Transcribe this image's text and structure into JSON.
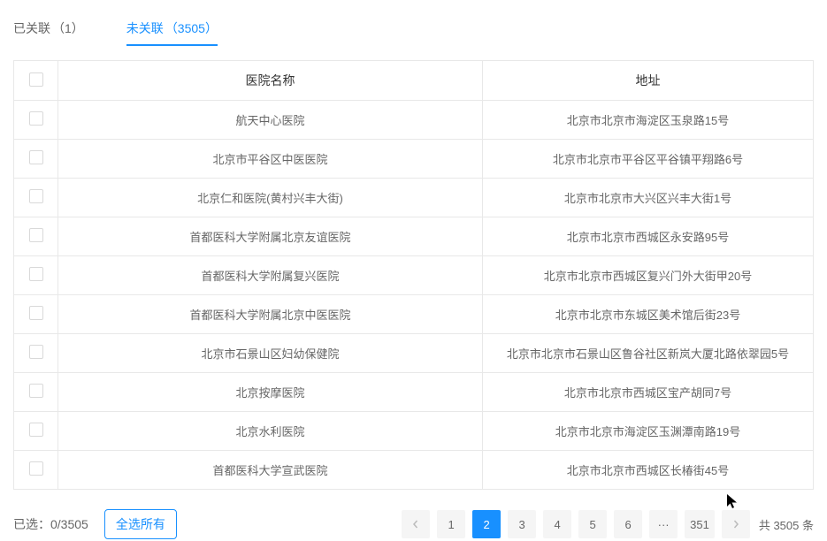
{
  "tabs": [
    {
      "label": "已关联",
      "count": "（1）"
    },
    {
      "label": "未关联",
      "count": "（3505）"
    }
  ],
  "table": {
    "headers": {
      "name": "医院名称",
      "address": "地址"
    },
    "rows": [
      {
        "name": "航天中心医院",
        "address": "北京市北京市海淀区玉泉路15号"
      },
      {
        "name": "北京市平谷区中医医院",
        "address": "北京市北京市平谷区平谷镇平翔路6号"
      },
      {
        "name": "北京仁和医院(黄村兴丰大街)",
        "address": "北京市北京市大兴区兴丰大街1号"
      },
      {
        "name": "首都医科大学附属北京友谊医院",
        "address": "北京市北京市西城区永安路95号"
      },
      {
        "name": "首都医科大学附属复兴医院",
        "address": "北京市北京市西城区复兴门外大街甲20号"
      },
      {
        "name": "首都医科大学附属北京中医医院",
        "address": "北京市北京市东城区美术馆后街23号"
      },
      {
        "name": "北京市石景山区妇幼保健院",
        "address": "北京市北京市石景山区鲁谷社区新岚大厦北路依翠园5号"
      },
      {
        "name": "北京按摩医院",
        "address": "北京市北京市西城区宝产胡同7号"
      },
      {
        "name": "北京水利医院",
        "address": "北京市北京市海淀区玉渊潭南路19号"
      },
      {
        "name": "首都医科大学宣武医院",
        "address": "北京市北京市西城区长椿街45号"
      }
    ]
  },
  "footer": {
    "selected_label": "已选：0/3505",
    "select_all_label": "全选所有",
    "pages": [
      "1",
      "2",
      "3",
      "4",
      "5",
      "6",
      "···",
      "351"
    ],
    "current_page_index": 1,
    "total_label": "共 3505 条"
  }
}
